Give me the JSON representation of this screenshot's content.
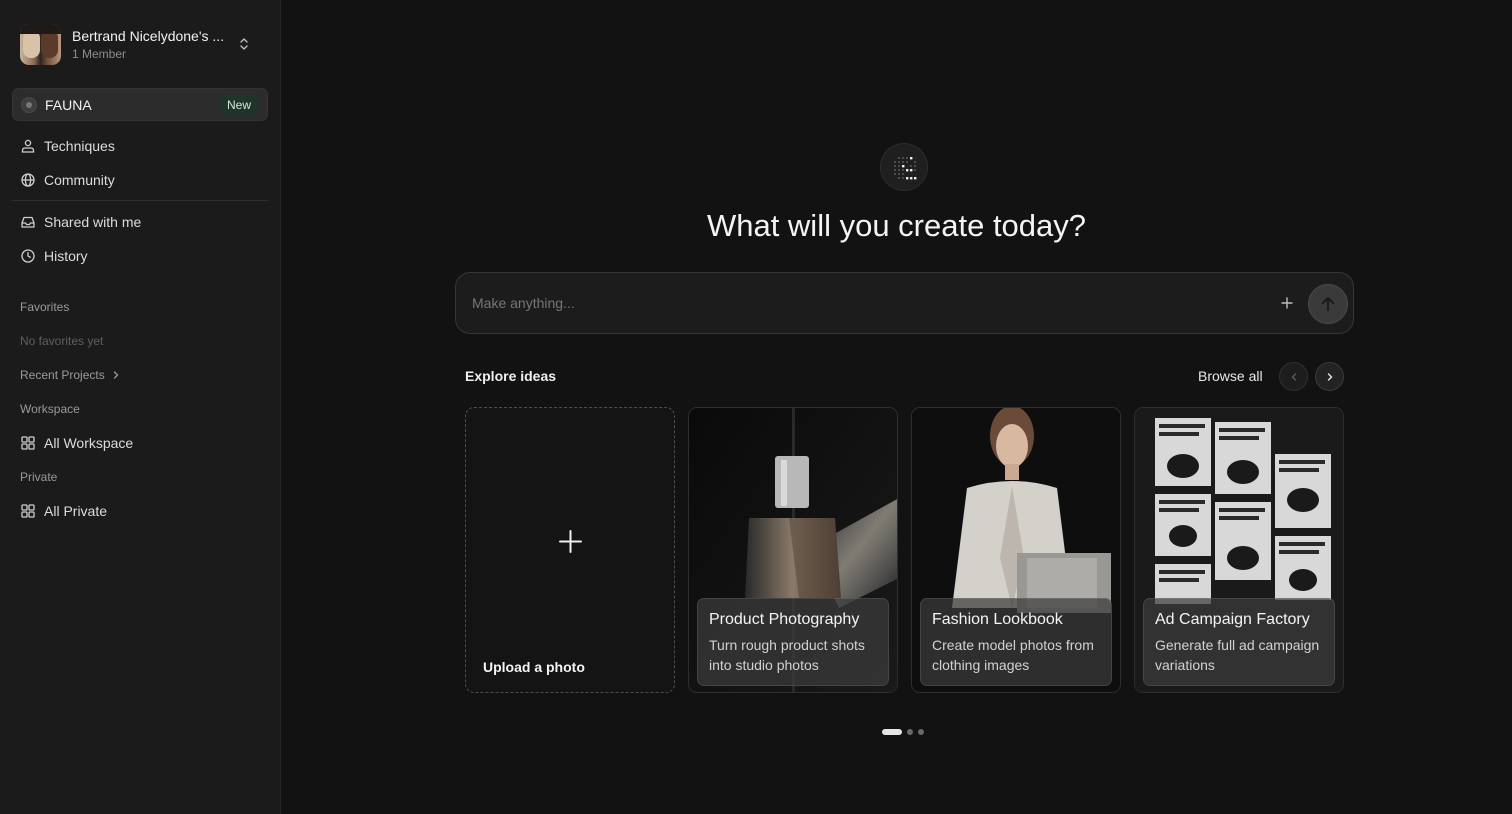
{
  "workspace": {
    "name": "Bertrand Nicelydone's ...",
    "members": "1 Member"
  },
  "fauna": {
    "label": "FAUNA",
    "badge": "New"
  },
  "nav": {
    "techniques": "Techniques",
    "community": "Community",
    "shared": "Shared with me",
    "history": "History"
  },
  "favorites": {
    "label": "Favorites",
    "empty": "No favorites yet"
  },
  "recent": {
    "label": "Recent Projects"
  },
  "workspace_section": {
    "label": "Workspace",
    "item": "All Workspace"
  },
  "private_section": {
    "label": "Private",
    "item": "All Private"
  },
  "main": {
    "headline": "What will you create today?",
    "prompt_placeholder": "Make anything...",
    "explore_title": "Explore ideas",
    "browse_all": "Browse all"
  },
  "cards": [
    {
      "title": "Upload a photo"
    },
    {
      "title": "Product Photography",
      "desc": "Turn rough product shots into studio photos"
    },
    {
      "title": "Fashion Lookbook",
      "desc": "Create model photos from clothing images"
    },
    {
      "title": "Ad Campaign Factory",
      "desc": "Generate full ad campaign variations"
    }
  ],
  "carousel": {
    "pages": 3,
    "active": 1
  },
  "colors": {
    "sidebar_bg": "#1b1b1b",
    "main_bg": "#121212",
    "badge_green": "#22342a"
  }
}
